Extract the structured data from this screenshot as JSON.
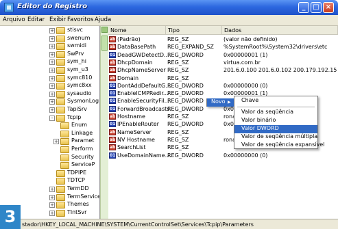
{
  "window": {
    "title": "Editor do Registro",
    "icon": "regedit-icon"
  },
  "menu": [
    "Arquivo",
    "Editar",
    "Exibir",
    "Favoritos",
    "Ajuda"
  ],
  "tree": [
    {
      "label": "stisvc",
      "expander": "+"
    },
    {
      "label": "swenum",
      "expander": "+"
    },
    {
      "label": "swmidi",
      "expander": "+"
    },
    {
      "label": "SwPrv",
      "expander": "+"
    },
    {
      "label": "sym_hi",
      "expander": "+"
    },
    {
      "label": "sym_u3",
      "expander": "+"
    },
    {
      "label": "symc810",
      "expander": "+"
    },
    {
      "label": "symc8xx",
      "expander": "+"
    },
    {
      "label": "sysaudio",
      "expander": "+"
    },
    {
      "label": "SysmonLog",
      "expander": "+"
    },
    {
      "label": "TapiSrv",
      "expander": "+"
    },
    {
      "label": "Tcpip",
      "expander": "-"
    },
    {
      "label": "Enum",
      "expander": ""
    },
    {
      "label": "Linkage",
      "expander": ""
    },
    {
      "label": "Paramet",
      "expander": "+"
    },
    {
      "label": "Perform",
      "expander": ""
    },
    {
      "label": "Security",
      "expander": ""
    },
    {
      "label": "ServiceP",
      "expander": ""
    },
    {
      "label": "TDPIPE",
      "expander": ""
    },
    {
      "label": "TDTCP",
      "expander": ""
    },
    {
      "label": "TermDD",
      "expander": "+"
    },
    {
      "label": "TermService",
      "expander": "+"
    },
    {
      "label": "Themes",
      "expander": "+"
    },
    {
      "label": "TlntSvr",
      "expander": "+"
    }
  ],
  "columns": {
    "name": "Nome",
    "type": "Tipo",
    "data": "Dados"
  },
  "rows": [
    {
      "name": "(Padrão)",
      "type": "REG_SZ",
      "data": "(valor não definido)",
      "icon": "string-value-icon"
    },
    {
      "name": "DataBasePath",
      "type": "REG_EXPAND_SZ",
      "data": "%SystemRoot%\\System32\\drivers\\etc",
      "icon": "string-value-icon"
    },
    {
      "name": "DeadGWDetectD...",
      "type": "REG_DWORD",
      "data": "0x00000001 (1)",
      "icon": "binary-value-icon"
    },
    {
      "name": "DhcpDomain",
      "type": "REG_SZ",
      "data": "virtua.com.br",
      "icon": "string-value-icon"
    },
    {
      "name": "DhcpNameServer",
      "type": "REG_SZ",
      "data": "201.6.0.100 201.6.0.102 200.179.192.15",
      "icon": "string-value-icon"
    },
    {
      "name": "Domain",
      "type": "REG_SZ",
      "data": "",
      "icon": "string-value-icon"
    },
    {
      "name": "DontAddDefaultG...",
      "type": "REG_DWORD",
      "data": "0x00000000 (0)",
      "icon": "binary-value-icon"
    },
    {
      "name": "EnableICMPRedir...",
      "type": "REG_DWORD",
      "data": "0x00000001 (1)",
      "icon": "binary-value-icon"
    },
    {
      "name": "EnableSecurityFil...",
      "type": "REG_DWORD",
      "data": "",
      "icon": "binary-value-icon"
    },
    {
      "name": "ForwardBroadcasts",
      "type": "REG_DWORD",
      "data": "0x000",
      "icon": "binary-value-icon"
    },
    {
      "name": "Hostname",
      "type": "REG_SZ",
      "data": "ronalc",
      "icon": "string-value-icon"
    },
    {
      "name": "IPEnableRouter",
      "type": "REG_DWORD",
      "data": "0x000",
      "icon": "binary-value-icon"
    },
    {
      "name": "NameServer",
      "type": "REG_SZ",
      "data": "",
      "icon": "string-value-icon"
    },
    {
      "name": "NV Hostname",
      "type": "REG_SZ",
      "data": "ronalc",
      "icon": "string-value-icon"
    },
    {
      "name": "SearchList",
      "type": "REG_SZ",
      "data": "",
      "icon": "string-value-icon"
    },
    {
      "name": "UseDomainName...",
      "type": "REG_DWORD",
      "data": "0x00000000 (0)",
      "icon": "binary-value-icon"
    }
  ],
  "context_menu": {
    "parent_label": "Novo",
    "arrow": "▶",
    "items": [
      "Chave",
      "Valor da seqüência",
      "Valor binário",
      "Valor DWORD",
      "Valor de seqüência múltipla",
      "Valor de seqüência expansível"
    ],
    "highlighted": "Valor DWORD"
  },
  "status": "stador\\HKEY_LOCAL_MACHINE\\SYSTEM\\CurrentControlSet\\Services\\Tcpip\\Parameters",
  "step_badge": "3",
  "colors": {
    "titlebar": "#2d68e0",
    "highlight": "#316ac5",
    "badge": "#2f86c8"
  }
}
